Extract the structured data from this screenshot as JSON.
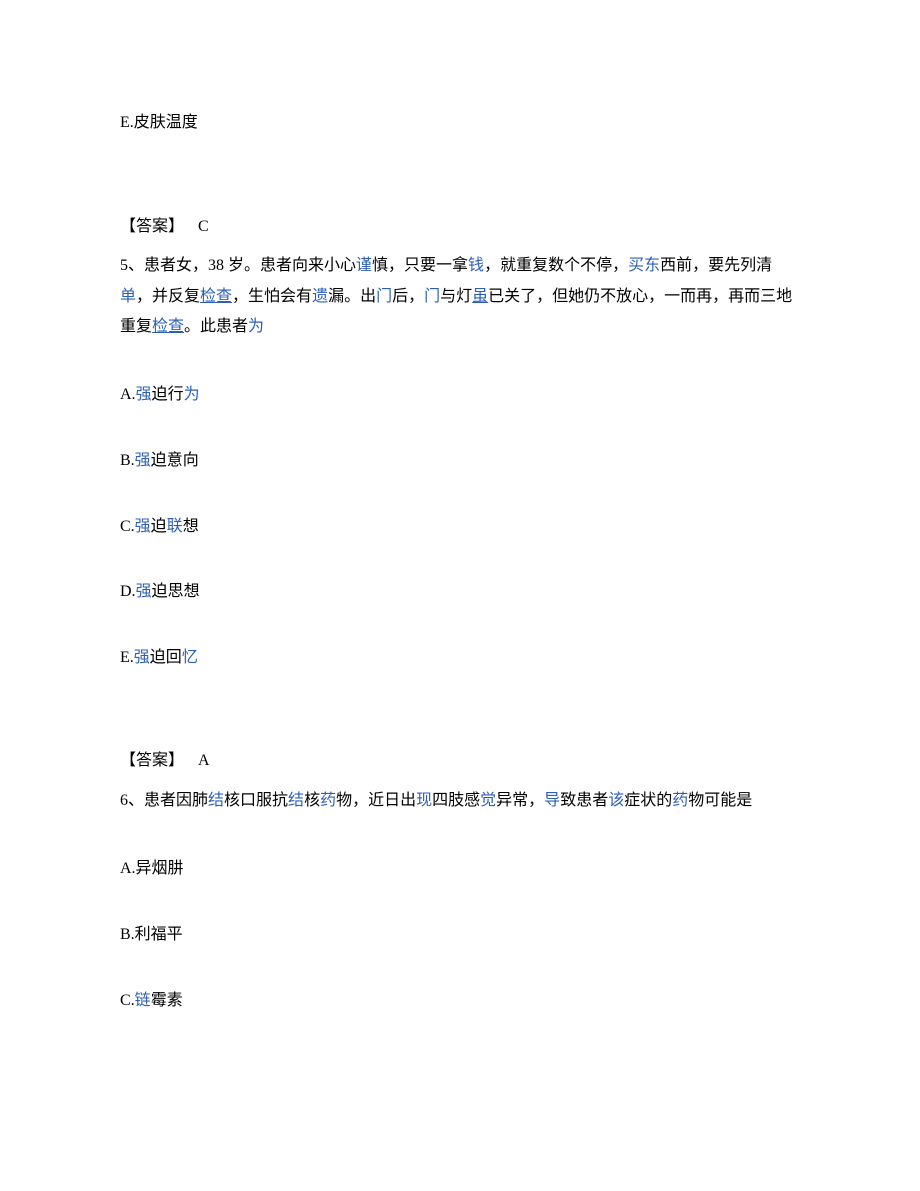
{
  "q4_tail": {
    "option_e": "E.皮肤温度",
    "answer_label": "【答案】",
    "answer_value": "C"
  },
  "q5": {
    "prefix": "5、患者女，38 岁。患者向来小心",
    "seg1": "谨",
    "seg2": "慎，只要一拿",
    "seg3": "钱",
    "seg4": "，就重复数个不停，",
    "seg5": "买东",
    "seg6": "西前，要先列清",
    "seg7": "单",
    "seg8": "，并反复",
    "seg9_u": "检查",
    "seg10": "，生怕会有",
    "seg11": "遗",
    "seg12": "漏。出",
    "seg13": "门",
    "seg14": "后，",
    "seg15": "门",
    "seg16": "与灯",
    "seg17_u": "虽",
    "seg18": "已关了，但她仍不放心，一而再，再而三地重复",
    "seg19_u": "检查",
    "seg20": "。此患者",
    "seg21": "为",
    "options": {
      "a_prefix": "A.",
      "a_blue": "强",
      "a_rest": "迫行",
      "a_blue2": "为",
      "b_prefix": "B.",
      "b_blue": "强",
      "b_rest": "迫意向",
      "c_prefix": "C.",
      "c_blue": "强",
      "c_rest": "迫",
      "c_blue2": "联",
      "c_rest2": "想",
      "d_prefix": "D.",
      "d_blue": "强",
      "d_rest": "迫思想",
      "e_prefix": "E.",
      "e_blue": "强",
      "e_rest": "迫回",
      "e_blue2": "忆"
    },
    "answer_label": "【答案】",
    "answer_value": "A"
  },
  "q6": {
    "prefix": "6、患者因肺",
    "seg1": "结",
    "seg2": "核口服抗",
    "seg3": "结",
    "seg4": "核",
    "seg5": "药",
    "seg6": "物，近日出",
    "seg7": "现",
    "seg8": "四肢感",
    "seg9": "觉",
    "seg10": "异常，",
    "seg11": "导",
    "seg12": "致患者",
    "seg13": "该",
    "seg14": "症状的",
    "seg15": "药",
    "seg16": "物可能是",
    "options": {
      "a": "A.异烟肼",
      "b": "B.利福平",
      "c_prefix": "C.",
      "c_blue": "链",
      "c_rest": "霉素"
    }
  }
}
